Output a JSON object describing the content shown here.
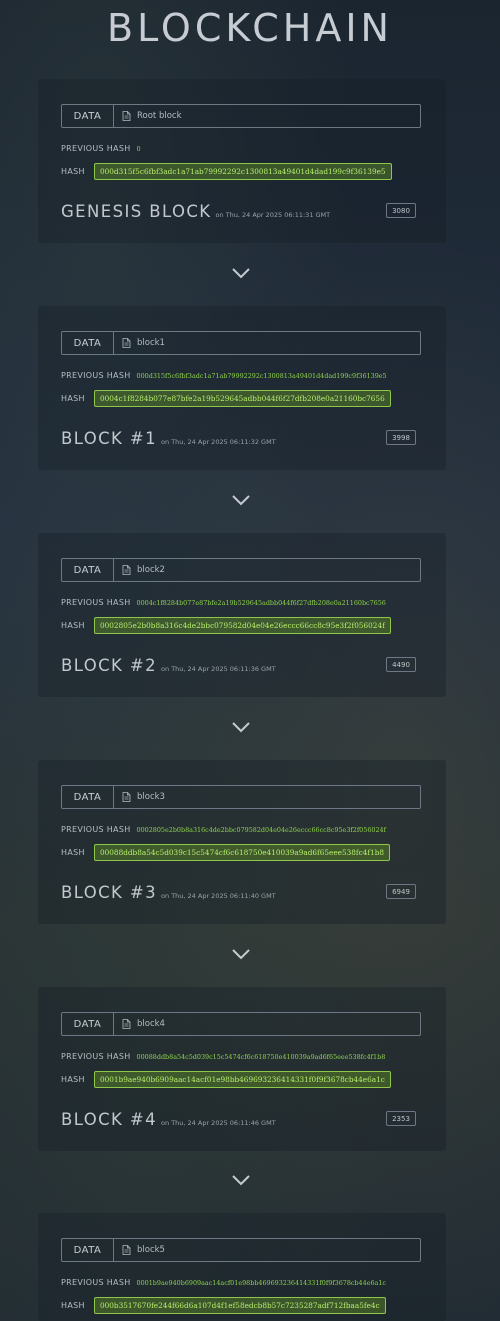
{
  "page": {
    "title": "BLOCKCHAIN"
  },
  "labels": {
    "data": "DATA",
    "previous_hash": "PREVIOUS HASH",
    "hash": "HASH"
  },
  "blocks": [
    {
      "data": "Root block",
      "previous_hash": "0",
      "hash": "000d315f5c6fbf3adc1a71ab79992292c1300813a49401d4dad199c9f36139e5",
      "title": "GENESIS BLOCK",
      "time": "on Thu, 24 Apr 2025 06:11:31 GMT",
      "nonce": "3080"
    },
    {
      "data": "block1",
      "previous_hash": "000d315f5c6fbf3adc1a71ab79992292c1300813a49401d4dad199c9f36139e5",
      "hash": "0004c1f8284b077e87bfe2a19b529645adbb044f6f27dfb208e0a21160bc7656",
      "title": "BLOCK #1",
      "time": "on Thu, 24 Apr 2025 06:11:32 GMT",
      "nonce": "3998"
    },
    {
      "data": "block2",
      "previous_hash": "0004c1f8284b077e87bfe2a19b529645adbb044f6f27dfb208e0a21160bc7656",
      "hash": "0002805e2b0b8a316c4de2bbc079582d04e04e26eccc66cc8c95e3f2f056024f",
      "title": "BLOCK #2",
      "time": "on Thu, 24 Apr 2025 06:11:36 GMT",
      "nonce": "4490"
    },
    {
      "data": "block3",
      "previous_hash": "0002805e2b0b8a316c4de2bbc079582d04e04e26eccc66cc8c95e3f2f056024f",
      "hash": "00088ddb8a54c5d039c15c5474cf6c618750e410039a9ad6f65eee538fc4f1b8",
      "title": "BLOCK #3",
      "time": "on Thu, 24 Apr 2025 06:11:40 GMT",
      "nonce": "6949"
    },
    {
      "data": "block4",
      "previous_hash": "00088ddb8a54c5d039c15c5474cf6c618750e410039a9ad6f65eee538fc4f1b8",
      "hash": "0001b9ae940b6909aac14acf01e98bb469693236414331f0f9f3678cb44e6a1c",
      "title": "BLOCK #4",
      "time": "on Thu, 24 Apr 2025 06:11:46 GMT",
      "nonce": "2353"
    },
    {
      "data": "block5",
      "previous_hash": "0001b9ae940b6909aac14acf01e98bb469693236414331f0f9f3678cb44e6a1c",
      "hash": "000b3517670fe244f66d6a107d4f1ef58edcb8b57c7235287adf712fbaa5fe4c",
      "title": "",
      "time": "",
      "nonce": ""
    }
  ],
  "colors": {
    "hash_green": "#8fd34b",
    "hash_box_bg": "#557d28",
    "text_light": "#c7ccd2"
  },
  "icons": {
    "data": "document-icon",
    "separator": "chevron-down-icon"
  }
}
